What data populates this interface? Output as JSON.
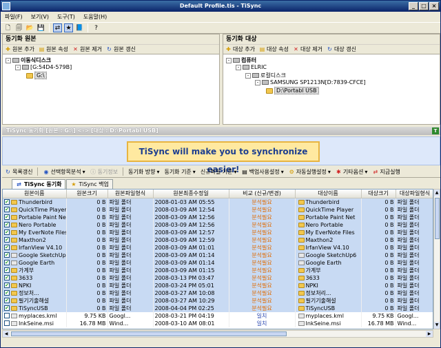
{
  "window": {
    "title": "Default Profile.tis - TiSync"
  },
  "menu": [
    "파일(F)",
    "보기(V)",
    "도구(T)",
    "도움말(H)"
  ],
  "source_pane": {
    "header": "동기화 원본",
    "tools": {
      "add": "원본 추가",
      "props": "원본 속성",
      "remove": "원본 제거",
      "refresh": "원본 갱신"
    },
    "tree": {
      "root": "이동식디스크",
      "drive": "[G:54D4-579B]",
      "folder": "G:\\"
    }
  },
  "target_pane": {
    "header": "동기화 대상",
    "tools": {
      "add": "대상 추가",
      "props": "대상 속성",
      "remove": "대상 제거",
      "refresh": "대상 갱신"
    },
    "tree": {
      "root": "컴퓨터",
      "host": "ELRIC",
      "local": "로컬디스크",
      "drive": "SAMSUNG SP1213N[D:7839-CFCE]",
      "folder": "D:\\Portabl USB"
    }
  },
  "status": {
    "text": "TiSync 동기화 [원본 : G:\\] <-> [대상 : D:\\Portabl USB]"
  },
  "banner": {
    "text": "TiSync will make you to synchronize easier!"
  },
  "actions": {
    "refresh": "목록갱신",
    "analyze": "선택항목분석",
    "sync_info": "동기정보",
    "direction": "동기화 방향",
    "criteria": "동기화 기준",
    "new_file": "신규파일 기준",
    "backup": "백업사용설정",
    "auto_run": "자동실행설정",
    "options": "기타옵션",
    "run_now": "지금실행"
  },
  "tabs": [
    "TiSync 동기화",
    "TiSync 백업"
  ],
  "table": {
    "columns": [
      "원본이름",
      "원본크기",
      "원본파일형식",
      "원본최종수정일",
      "비교 (신규/변경)",
      "대상이름",
      "대상크기",
      "대상파일형식"
    ],
    "rows": [
      {
        "name": "Thunderbird",
        "size": "0 B",
        "type": "파일 폴더",
        "date": "2008-01-03 AM 05:55",
        "cmp": "분석필요",
        "tname": "Thunderbird",
        "tsize": "0 B",
        "ttype": "파일 폴더",
        "kind": "folder",
        "checked": true
      },
      {
        "name": "QuickTime Player",
        "size": "0 B",
        "type": "파일 폴더",
        "date": "2008-03-09 AM 12:54",
        "cmp": "분석필요",
        "tname": "QuickTime Player",
        "tsize": "0 B",
        "ttype": "파일 폴더",
        "kind": "folder",
        "checked": true
      },
      {
        "name": "Portable Paint Net",
        "size": "0 B",
        "type": "파일 폴더",
        "date": "2008-03-09 AM 12:56",
        "cmp": "분석필요",
        "tname": "Portable Paint Net",
        "tsize": "0 B",
        "ttype": "파일 폴더",
        "kind": "folder",
        "checked": true
      },
      {
        "name": "Nero Portable",
        "size": "0 B",
        "type": "파일 폴더",
        "date": "2008-03-09 AM 12:56",
        "cmp": "분석필요",
        "tname": "Nero Portable",
        "tsize": "0 B",
        "ttype": "파일 폴더",
        "kind": "folder",
        "checked": true
      },
      {
        "name": "My EverNote Files",
        "size": "0 B",
        "type": "파일 폴더",
        "date": "2008-03-09 AM 12:57",
        "cmp": "분석필요",
        "tname": "My EverNote Files",
        "tsize": "0 B",
        "ttype": "파일 폴더",
        "kind": "folder",
        "checked": true
      },
      {
        "name": "Maxthon2",
        "size": "0 B",
        "type": "파일 폴더",
        "date": "2008-03-09 AM 12:59",
        "cmp": "분석필요",
        "tname": "Maxthon2",
        "tsize": "0 B",
        "ttype": "파일 폴더",
        "kind": "folder",
        "checked": true
      },
      {
        "name": "IrfanView V4.10",
        "size": "0 B",
        "type": "파일 폴더",
        "date": "2008-03-09 AM 01:01",
        "cmp": "분석필요",
        "tname": "IrfanView V4.10",
        "tsize": "0 B",
        "ttype": "파일 폴더",
        "kind": "folder",
        "checked": true
      },
      {
        "name": "Google SketchUp6",
        "size": "0 B",
        "type": "파일 폴더",
        "date": "2008-03-09 AM 01:14",
        "cmp": "분석필요",
        "tname": "Google SketchUp6",
        "tsize": "0 B",
        "ttype": "파일 폴더",
        "kind": "file",
        "checked": true
      },
      {
        "name": "Google Earth",
        "size": "0 B",
        "type": "파일 폴더",
        "date": "2008-03-09 AM 01:14",
        "cmp": "분석필요",
        "tname": "Google Earth",
        "tsize": "0 B",
        "ttype": "파일 폴더",
        "kind": "file",
        "checked": true
      },
      {
        "name": "가계부",
        "size": "0 B",
        "type": "파일 폴더",
        "date": "2008-03-09 AM 01:15",
        "cmp": "분석필요",
        "tname": "가계부",
        "tsize": "0 B",
        "ttype": "파일 폴더",
        "kind": "folder",
        "checked": true
      },
      {
        "name": "3633",
        "size": "0 B",
        "type": "파일 폴더",
        "date": "2008-03-13 PM 03:47",
        "cmp": "분석필요",
        "tname": "3633",
        "tsize": "0 B",
        "ttype": "파일 폴더",
        "kind": "folder",
        "checked": true
      },
      {
        "name": "NPKI",
        "size": "0 B",
        "type": "파일 폴더",
        "date": "2008-03-24 PM 05:01",
        "cmp": "분석필요",
        "tname": "NPKI",
        "tsize": "0 B",
        "ttype": "파일 폴더",
        "kind": "folder",
        "checked": true
      },
      {
        "name": "정보처...",
        "size": "0 B",
        "type": "파일 폴더",
        "date": "2008-03-27 AM 10:08",
        "cmp": "분석필요",
        "tname": "정보처리...",
        "tsize": "0 B",
        "ttype": "파일 폴더",
        "kind": "folder",
        "checked": true
      },
      {
        "name": "필기기출해설",
        "size": "0 B",
        "type": "파일 폴더",
        "date": "2008-03-27 AM 10:29",
        "cmp": "분석필요",
        "tname": "필기기출해설",
        "tsize": "0 B",
        "ttype": "파일 폴더",
        "kind": "folder",
        "checked": true
      },
      {
        "name": "TiSyncUSB",
        "size": "0 B",
        "type": "파일 폴더",
        "date": "2008-04-04 PM 02:25",
        "cmp": "분석필요",
        "tname": "TiSyncUSB",
        "tsize": "0 B",
        "ttype": "파일 폴더",
        "kind": "folder",
        "checked": true
      },
      {
        "name": "myplaces.kml",
        "size": "9.75 KB",
        "type": "Googl...",
        "date": "2008-03-21 PM 04:19",
        "cmp": "일치",
        "tname": "myplaces.kml",
        "tsize": "9.75 KB",
        "ttype": "Googl...",
        "kind": "file",
        "checked": false
      },
      {
        "name": "InkSeine.msi",
        "size": "16.78 MB",
        "type": "Wind...",
        "date": "2008-03-10 AM 08:01",
        "cmp": "일치",
        "tname": "InkSeine.msi",
        "tsize": "16.78 MB",
        "ttype": "Wind...",
        "kind": "file",
        "checked": false
      }
    ]
  }
}
